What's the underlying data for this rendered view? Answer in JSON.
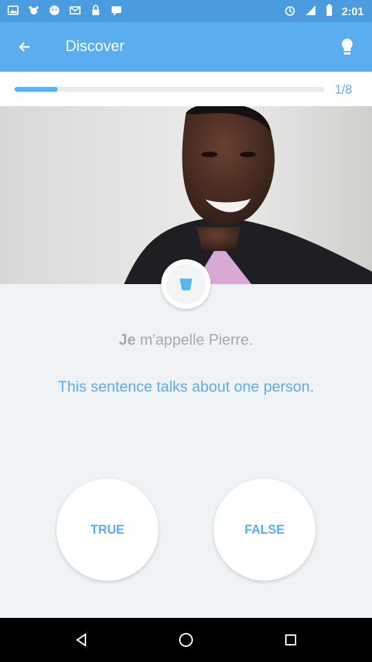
{
  "status_bar": {
    "time": "2:01",
    "icons": [
      "gallery-icon",
      "pet-icon",
      "mascot-icon",
      "mail-icon",
      "lock-icon",
      "chat-icon",
      "alarm-icon",
      "signal-icon",
      "battery-icon"
    ]
  },
  "app_bar": {
    "title": "Discover",
    "back_icon": "arrow-back-icon",
    "tip_icon": "lightbulb-icon"
  },
  "progress": {
    "text": "1/8",
    "fraction": 0.14
  },
  "lesson": {
    "phrase_bold": "Je",
    "phrase_rest": " m'appelle Pierre.",
    "question": "This sentence talks about one person.",
    "answers": {
      "true_label": "TRUE",
      "false_label": "FALSE"
    }
  },
  "colors": {
    "status_bar": "#4a9be0",
    "app_bar": "#5aaef0",
    "accent": "#5aaef0",
    "background": "#eff3f6"
  },
  "navigation": {
    "buttons": [
      "back",
      "home",
      "recents"
    ]
  }
}
